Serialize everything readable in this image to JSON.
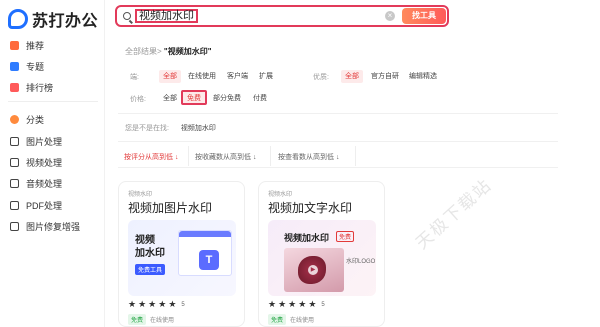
{
  "app": {
    "name": "苏打办公"
  },
  "sidebar": {
    "items": [
      {
        "label": "推荐",
        "icon": "recommend-icon",
        "color": "#ff6a3d"
      },
      {
        "label": "专题",
        "icon": "topic-icon",
        "color": "#2f7cff"
      },
      {
        "label": "排行榜",
        "icon": "ranking-icon",
        "color": "#ff5a5a"
      },
      {
        "label": "分类",
        "icon": "category-icon",
        "color": "#ff8a3d"
      },
      {
        "label": "图片处理",
        "icon": "image-icon",
        "color": "#444444"
      },
      {
        "label": "视频处理",
        "icon": "video-icon",
        "color": "#444444"
      },
      {
        "label": "音频处理",
        "icon": "audio-icon",
        "color": "#444444"
      },
      {
        "label": "PDF处理",
        "icon": "pdf-icon",
        "color": "#444444"
      },
      {
        "label": "图片修复增强",
        "icon": "image-repair-icon",
        "color": "#444444"
      }
    ]
  },
  "search": {
    "value": "视频加水印",
    "button": "找工具"
  },
  "results": {
    "prefix": "全部结果>",
    "query": "\"视频加水印\""
  },
  "filters": {
    "row1": {
      "label": "端:",
      "options": [
        "全部",
        "在线使用",
        "客户端",
        "扩展"
      ],
      "active": 0
    },
    "row1b": {
      "label": "优质:",
      "options": [
        "全部",
        "官方自研",
        "编辑精选"
      ],
      "active": 0
    },
    "row2": {
      "label": "价格:",
      "options": [
        "全部",
        "免费",
        "部分免费",
        "付费"
      ],
      "active": 1
    }
  },
  "searched": {
    "label": "您是不是在找:",
    "value": "视频加水印"
  },
  "sorts": [
    {
      "label": "按评分从高到低 ↓",
      "active": true
    },
    {
      "label": "按收藏数从高到低 ↓",
      "active": false
    },
    {
      "label": "按查看数从高到低 ↓",
      "active": false
    }
  ],
  "cards": [
    {
      "category": "视频水印",
      "title": "视频加图片水印",
      "thumb_title": "视频\n加水印",
      "thumb_badge": "免费工具",
      "rating": "5",
      "free": "免费",
      "mode": "在线使用"
    },
    {
      "category": "视频水印",
      "title": "视频加文字水印",
      "thumb_title": "视频加水印",
      "thumb_badge": "免费",
      "thumb_logo": "水印LOGO",
      "rating": "5",
      "free": "免费",
      "mode": "在线使用"
    }
  ],
  "watermark": "天极下载站",
  "colors": {
    "accent": "#e23a3a",
    "brand": "#1f6fff",
    "free": "#2aa84a"
  }
}
